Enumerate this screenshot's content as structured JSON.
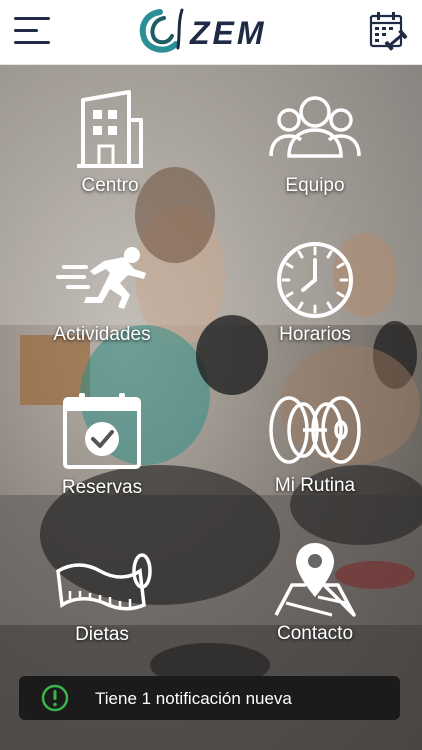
{
  "header": {
    "brand": "ZEM",
    "menu_icon": "hamburger-menu-icon",
    "calendar_icon": "calendar-dumbbell-icon",
    "accent_color": "#2a8f96",
    "text_color": "#1f2a44"
  },
  "menu": {
    "items": [
      {
        "label": "Centro",
        "icon": "building-icon"
      },
      {
        "label": "Equipo",
        "icon": "team-icon"
      },
      {
        "label": "Actividades",
        "icon": "running-person-icon"
      },
      {
        "label": "Horarios",
        "icon": "clock-icon"
      },
      {
        "label": "Reservas",
        "icon": "calendar-check-icon"
      },
      {
        "label": "Mi Rutina",
        "icon": "weight-plates-icon"
      },
      {
        "label": "Dietas",
        "icon": "measuring-tape-icon"
      },
      {
        "label": "Contacto",
        "icon": "map-pin-icon"
      }
    ]
  },
  "notification": {
    "text": "Tiene 1 notificación nueva",
    "icon": "exclamation-circle-icon",
    "icon_color": "#3bb54a"
  }
}
